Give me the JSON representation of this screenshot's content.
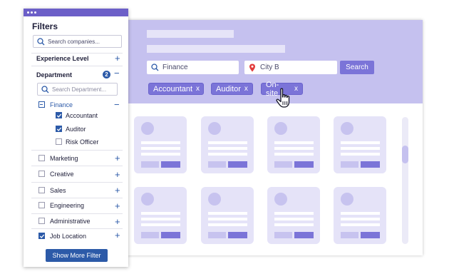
{
  "filters": {
    "title": "Filters",
    "company_search_placeholder": "Search companies...",
    "experience_level_label": "Experience Level",
    "department": {
      "label": "Department",
      "count_badge": "2",
      "search_placeholder": "Search Department...",
      "finance_label": "Finance",
      "sub_items": [
        {
          "label": "Accountant",
          "checked": true
        },
        {
          "label": "Auditor",
          "checked": true
        },
        {
          "label": "Risk Officer",
          "checked": false
        }
      ]
    },
    "categories": [
      {
        "label": "Marketing",
        "checked": false
      },
      {
        "label": "Creative",
        "checked": false
      },
      {
        "label": "Sales",
        "checked": false
      },
      {
        "label": "Engineering",
        "checked": false
      },
      {
        "label": "Administrative",
        "checked": false
      },
      {
        "label": "Job Location",
        "checked": true
      }
    ],
    "show_more_label": "Show More Filter"
  },
  "search": {
    "keyword_value": "Finance",
    "location_value": "City B",
    "button_label": "Search"
  },
  "chips": [
    {
      "label": "Accountant",
      "remove": "x"
    },
    {
      "label": "Auditor",
      "remove": "x"
    },
    {
      "label": "On-site",
      "remove": "x"
    }
  ],
  "colors": {
    "header_bg": "#c5c1ef",
    "accent": "#7b74d8",
    "panel_accent": "#2c5aa8",
    "titlebar": "#6c5fc8"
  }
}
